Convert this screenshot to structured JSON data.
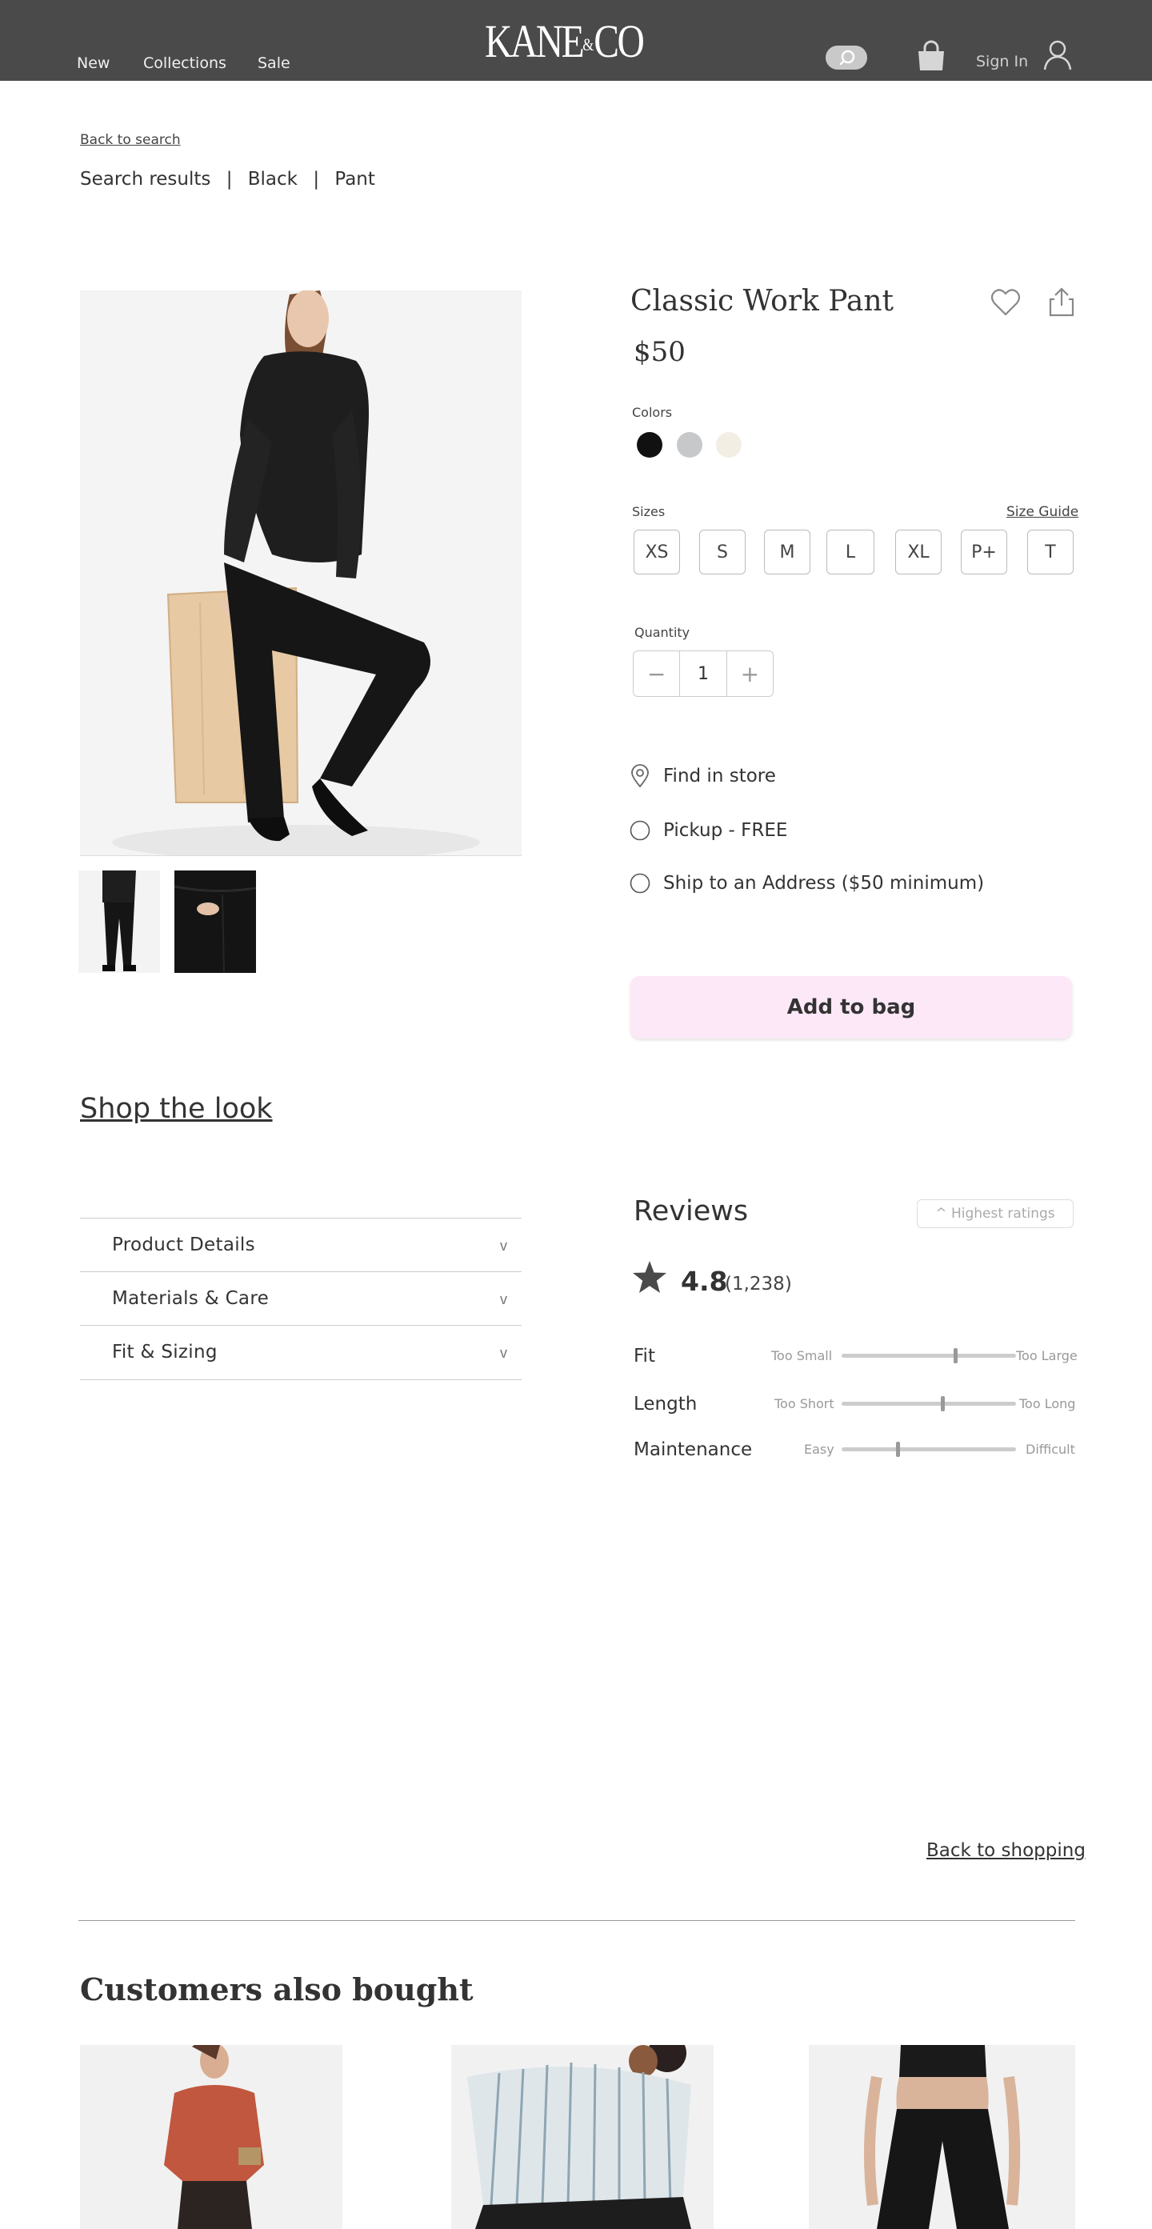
{
  "header": {
    "nav": [
      "New",
      "Collections",
      "Sale"
    ],
    "logo": {
      "left": "KANE",
      "amp": "&",
      "right": "CO"
    },
    "sign_in": "Sign In"
  },
  "back_to_search": "Back to  search",
  "breadcrumb": [
    "Search results",
    "|",
    "Black",
    "|",
    "Pant"
  ],
  "product": {
    "title": "Classic Work Pant",
    "price": "$50",
    "colors_label": "Colors",
    "colors": [
      "#111111",
      "#c7c8ca",
      "#f3eee4"
    ],
    "sizes_label": "Sizes",
    "size_guide": "Size Guide",
    "sizes": [
      "XS",
      "S",
      "M",
      "L",
      "XL",
      "P+",
      "T"
    ],
    "quantity_label": "Quantity",
    "quantity": "1",
    "minus": "−",
    "plus": "+",
    "fulfillment": [
      "Find in store",
      "Pickup - FREE",
      "Ship to an Address ($50 minimum)"
    ],
    "add_to_bag": "Add to bag"
  },
  "shop_the_look": "Shop the look",
  "accordion": [
    {
      "label": "Product Details",
      "chevron": "v"
    },
    {
      "label": "Materials & Care",
      "chevron": "v"
    },
    {
      "label": "Fit & Sizing",
      "chevron": "v"
    }
  ],
  "reviews": {
    "title": "Reviews",
    "sort": "^   Highest ratings",
    "rating": "4.8",
    "count": "(1,238)",
    "meters": [
      {
        "label": "Fit",
        "low": "Too Small",
        "high": "Too Large",
        "value": 0.65
      },
      {
        "label": "Length",
        "low": "Too Short",
        "high": "Too Long",
        "value": 0.58
      },
      {
        "label": "Maintenance",
        "low": "Easy",
        "high": "Difficult",
        "value": 0.32
      }
    ]
  },
  "back_to_shopping": "Back to shopping",
  "also_bought_title": "Customers also bought"
}
